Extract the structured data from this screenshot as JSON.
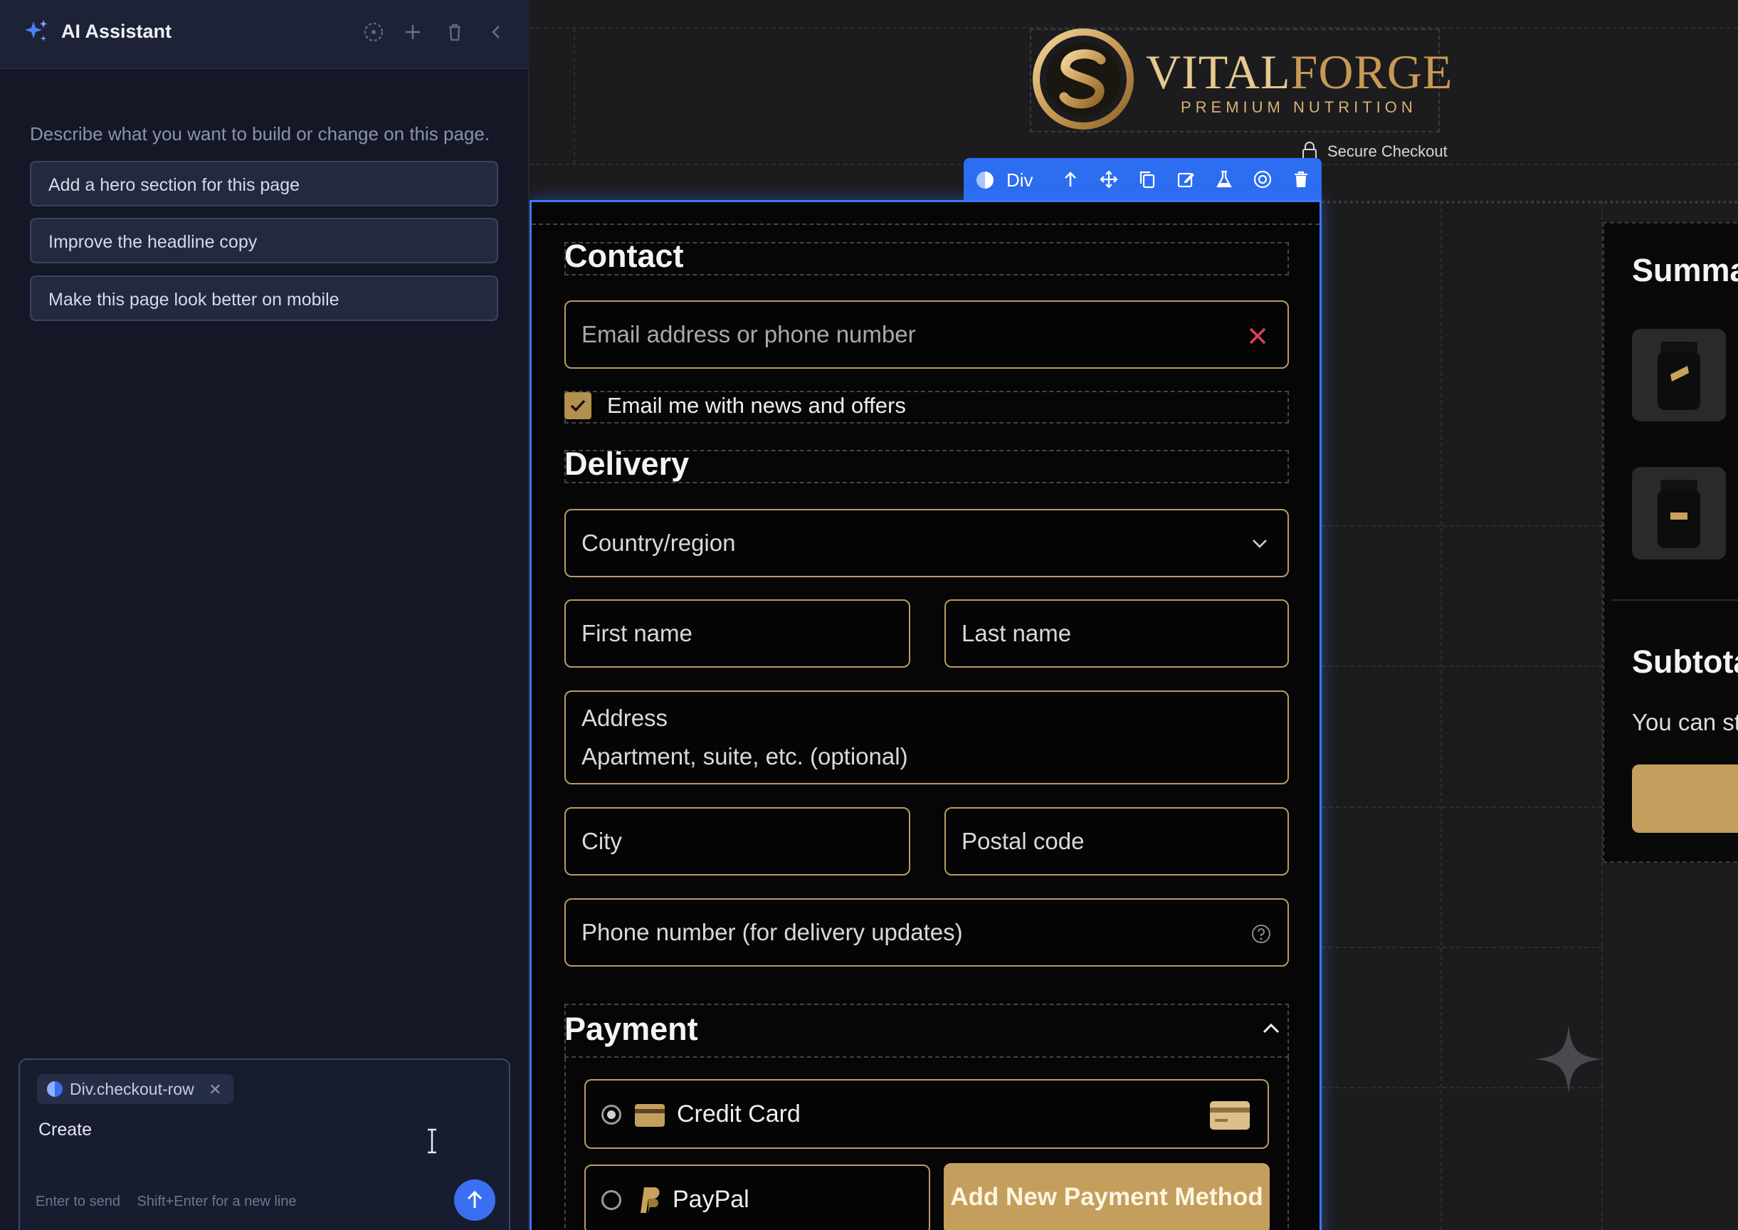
{
  "sidebar": {
    "title": "AI Assistant",
    "intro": "Describe what you want to build or change on this page.",
    "suggestions": [
      "Add a hero section for this page",
      "Improve the headline copy",
      "Make this page look better on mobile"
    ],
    "composer": {
      "chip_label": "Div.checkout-row",
      "typed_text": "Create",
      "hint_send": "Enter to send",
      "hint_newline": "Shift+Enter for a new line"
    }
  },
  "canvas": {
    "brand_primary": "VITAL",
    "brand_secondary": "FORGE",
    "brand_tagline": "PREMIUM NUTRITION",
    "secure_label": "Secure Checkout",
    "toolbar_label": "Div",
    "contact": {
      "title": "Contact",
      "email_placeholder": "Email address or phone number",
      "newsletter_label": "Email me with news and offers",
      "newsletter_checked": true
    },
    "delivery": {
      "title": "Delivery",
      "country_placeholder": "Country/region",
      "first_name": "First name",
      "last_name": "Last name",
      "address": "Address",
      "apartment": "Apartment, suite, etc. (optional)",
      "city": "City",
      "postal_code": "Postal code",
      "phone": "Phone number (for delivery updates)"
    },
    "payment": {
      "title": "Payment",
      "options": [
        "Credit Card",
        "PayPal"
      ],
      "selected": "Credit Card",
      "add_button": "Add New Payment Method"
    },
    "summary": {
      "title": "Summary",
      "subtotal": "Subtotal",
      "text": "You can stay"
    }
  },
  "colors": {
    "accent_gold": "#c39e5d",
    "selection_blue": "#3a78ff",
    "error_red": "#e0414f",
    "sidebar_bg": "#131726"
  }
}
